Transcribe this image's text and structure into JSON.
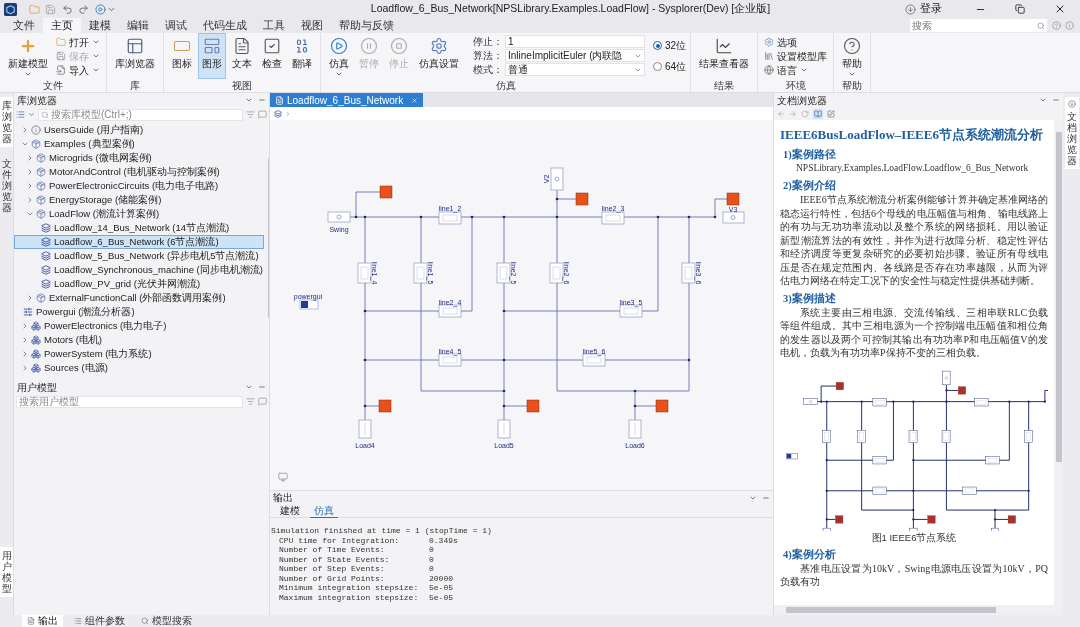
{
  "title_bar": {
    "title": "Loadflow_6_Bus_Network[NPSLibrary.Examples.LoadFlow] - Sysplorer(Dev) [企业版]",
    "login": "登录"
  },
  "menu_tabs": [
    {
      "label": "文件",
      "selected": false
    },
    {
      "label": "主页",
      "selected": true
    },
    {
      "label": "建模",
      "selected": false
    },
    {
      "label": "编辑",
      "selected": false
    },
    {
      "label": "调试",
      "selected": false
    },
    {
      "label": "代码生成",
      "selected": false
    },
    {
      "label": "工具",
      "selected": false
    },
    {
      "label": "视图",
      "selected": false
    },
    {
      "label": "帮助与反馈",
      "selected": false
    }
  ],
  "search": {
    "placeholder": "搜索"
  },
  "ribbon": {
    "groups": [
      {
        "label": "文件",
        "buttons": [
          {
            "label": "新建模型",
            "kind": "large",
            "disabled": false,
            "dropdown": true
          },
          {
            "label": "打开",
            "kind": "small",
            "disabled": false,
            "dropdown": true
          },
          {
            "label": "保存",
            "kind": "small",
            "disabled": true,
            "dropdown": true
          },
          {
            "label": "导入",
            "kind": "small",
            "disabled": false,
            "dropdown": true
          }
        ]
      },
      {
        "label": "库",
        "buttons": [
          {
            "label": "库浏览器",
            "kind": "large",
            "disabled": false,
            "dropdown": false
          }
        ]
      },
      {
        "label": "视图",
        "buttons": [
          {
            "label": "图标",
            "kind": "large",
            "disabled": false,
            "dropdown": false,
            "selected": false
          },
          {
            "label": "图形",
            "kind": "large",
            "disabled": false,
            "dropdown": false,
            "selected": true
          },
          {
            "label": "文本",
            "kind": "large",
            "disabled": false,
            "dropdown": false,
            "selected": false
          },
          {
            "label": "检查",
            "kind": "large",
            "disabled": false,
            "dropdown": false,
            "selected": false
          },
          {
            "label": "翻译",
            "kind": "large",
            "disabled": false,
            "dropdown": false,
            "selected": false
          }
        ]
      },
      {
        "label": "仿真",
        "buttons": [
          {
            "label": "仿真",
            "kind": "large",
            "disabled": false,
            "dropdown": true
          },
          {
            "label": "暂停",
            "kind": "large",
            "disabled": true,
            "dropdown": false
          },
          {
            "label": "停止",
            "kind": "large",
            "disabled": true,
            "dropdown": false
          },
          {
            "label": "仿真设置",
            "kind": "large",
            "disabled": false,
            "dropdown": false
          }
        ],
        "fields": [
          {
            "label": "停止：",
            "value": "1",
            "kind": "text"
          },
          {
            "label": "算法：",
            "value": "InlineImplicitEuler (内联隐",
            "kind": "select"
          },
          {
            "label": "模式：",
            "value": "普通",
            "kind": "select"
          }
        ],
        "radios": [
          {
            "label": "32位",
            "selected": true
          },
          {
            "label": "64位",
            "selected": false
          }
        ]
      },
      {
        "label": "结果",
        "buttons": [
          {
            "label": "结果查看器",
            "kind": "large",
            "disabled": false,
            "dropdown": false
          }
        ]
      },
      {
        "label": "环境",
        "buttons": [
          {
            "label": "选项",
            "kind": "small",
            "disabled": false,
            "dropdown": false
          },
          {
            "label": "设置模型库",
            "kind": "small",
            "disabled": false,
            "dropdown": false
          },
          {
            "label": "语言",
            "kind": "small",
            "disabled": false,
            "dropdown": true
          }
        ]
      },
      {
        "label": "帮助",
        "buttons": [
          {
            "label": "帮助",
            "kind": "large",
            "disabled": false,
            "dropdown": true
          }
        ]
      }
    ]
  },
  "left_strip": [
    {
      "label": "库浏览器",
      "selected": true
    },
    {
      "label": "文件浏览器",
      "selected": false
    },
    {
      "label": "用户模型",
      "selected": true
    }
  ],
  "library_browser": {
    "title": "库浏览器",
    "search_placeholder": "搜索库模型(Ctrl+;)",
    "tree": [
      {
        "label": "UsersGuide (用户指南)",
        "kind": "guide",
        "selected": false,
        "expanded": false
      },
      {
        "label": "Examples (典型案例)",
        "kind": "package",
        "selected": false,
        "expanded": true,
        "children": [
          {
            "label": "Microgrids (微电网案例)",
            "kind": "package",
            "selected": false,
            "expanded": false
          },
          {
            "label": "MotorAndControl (电机驱动与控制案例)",
            "kind": "package",
            "selected": false,
            "expanded": false
          },
          {
            "label": "PowerElectronicCircuits (电力电子电路)",
            "kind": "package",
            "selected": false,
            "expanded": false
          },
          {
            "label": "EnergyStorage (储能案例)",
            "kind": "package",
            "selected": false,
            "expanded": false
          },
          {
            "label": "LoadFlow (潮流计算案例)",
            "kind": "package",
            "selected": false,
            "expanded": true,
            "children": [
              {
                "label": "Loadflow_14_Bus_Network (14节点潮流)",
                "kind": "model",
                "selected": false
              },
              {
                "label": "Loadflow_6_Bus_Network (6节点潮流)",
                "kind": "model",
                "selected": true
              },
              {
                "label": "Loadflow_5_Bus_Network (异步电机5节点潮流)",
                "kind": "model",
                "selected": false
              },
              {
                "label": "Loadflow_Synchronous_machine (同步电机潮流)",
                "kind": "model",
                "selected": false
              },
              {
                "label": "Loadflow_PV_grid (光伏并网潮流)",
                "kind": "model",
                "selected": false
              }
            ]
          },
          {
            "label": "ExternalFunctionCall (外部函数调用案例)",
            "kind": "package",
            "selected": false,
            "expanded": false
          }
        ]
      },
      {
        "label": "Powergui (潮流分析器)",
        "kind": "tool",
        "selected": false
      },
      {
        "label": "PowerElectronics (电力电子)",
        "kind": "library",
        "selected": false,
        "expanded": false
      },
      {
        "label": "Motors (电机)",
        "kind": "library",
        "selected": false,
        "expanded": false
      },
      {
        "label": "PowerSystem (电力系统)",
        "kind": "library",
        "selected": false,
        "expanded": false
      },
      {
        "label": "Sources (电源)",
        "kind": "library",
        "selected": false,
        "expanded": false
      }
    ]
  },
  "user_models": {
    "title": "用户模型",
    "search_placeholder": "搜索用户模型"
  },
  "editor": {
    "tabs": [
      {
        "label": "Loadflow_6_Bus_Network",
        "selected": true
      }
    ],
    "diagram": {
      "labels": [
        "Swing",
        "line1_2",
        "V2",
        "line2_3",
        "V3",
        "line1_4",
        "line1_5",
        "line2_5",
        "line2_6",
        "line3_6",
        "powergui",
        "line2_4",
        "line3_5",
        "line4_5",
        "line5_6",
        "Load4",
        "Load5",
        "Load6"
      ]
    }
  },
  "output": {
    "title": "输出",
    "tabs": [
      {
        "label": "建模",
        "selected": false
      },
      {
        "label": "仿真",
        "selected": true
      }
    ],
    "log_header": "Simulation finished at time = 1 (stopTime = 1)",
    "log_rows": [
      {
        "label": "CPU time for Integration:",
        "value": "0.349s"
      },
      {
        "label": "Number of Time Events:",
        "value": "0"
      },
      {
        "label": "Number of State Events:",
        "value": "0"
      },
      {
        "label": "Number of Step Events:",
        "value": "0"
      },
      {
        "label": "Number of Grid Points:",
        "value": "20000"
      },
      {
        "label": "Minimum integration stepsize:",
        "value": "5e-05"
      },
      {
        "label": "Maximum integration stepsize:",
        "value": "5e-05"
      }
    ]
  },
  "bottom_tabs": [
    {
      "label": "输出",
      "selected": true
    },
    {
      "label": "组件参数",
      "selected": false
    },
    {
      "label": "模型搜索",
      "selected": false
    }
  ],
  "doc_browser": {
    "title": "文档浏览器",
    "side_tab": "文档浏览器",
    "doc": {
      "title": "IEEE6BusLoadFlow–IEEE6节点系统潮流分析",
      "sections": [
        {
          "heading": "1)案例路径",
          "path": "NPSLibrary.Examples.LoadFlow.Loadflow_6_Bus_Network"
        },
        {
          "heading": "2)案例介绍",
          "text": "IEEE6节点系统潮流分析案例能够计算并确定基准网络的稳态运行特性，包括6个母线的电压幅值与相角、输电线路上的有功与无功功率流动以及整个系统的网络损耗。用以验证新型潮流算法的有效性，并作为进行故障分析、稳定性评估和经济调度等更复杂研究的必要初始步骤。验证所有母线电压是否在规定范围内、各线路是否存在功率越限，从而为评估电力网络在特定工况下的安全性与稳定性提供基础判断。"
        },
        {
          "heading": "3)案例描述",
          "text": "系统主要由三相电源、交流传输线、三相串联RLC负载等组件组成。其中三相电源为一个控制端电压幅值和相位角的发生器以及两个可控制其输出有功功率P和电压幅值V的发电机，负载为有功功率P保持不变的三相负载。",
          "figure": {
            "caption": "图1 IEEE6节点系统"
          }
        },
        {
          "heading": "4)案例分析",
          "text": "基准电压设置为10kV，Swing电源电压设置为10kV，PQ负载有功"
        }
      ]
    }
  }
}
